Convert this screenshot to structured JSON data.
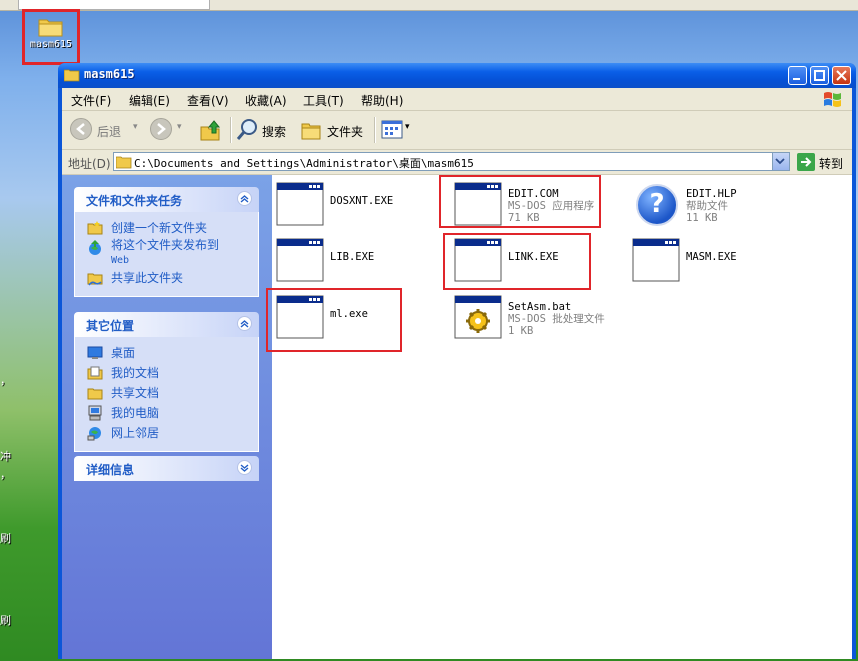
{
  "desktop": {
    "icon_label": "masm615",
    "side_chars": [
      "，",
      "冲",
      "，",
      "刷",
      "刷"
    ]
  },
  "window": {
    "title": "masm615",
    "controls": [
      "minimize",
      "maximize",
      "close"
    ]
  },
  "menu": [
    {
      "label": "文件(F)"
    },
    {
      "label": "编辑(E)"
    },
    {
      "label": "查看(V)"
    },
    {
      "label": "收藏(A)"
    },
    {
      "label": "工具(T)"
    },
    {
      "label": "帮助(H)"
    }
  ],
  "toolbar": {
    "back_label": "后退",
    "search_label": "搜索",
    "folders_label": "文件夹"
  },
  "address": {
    "label": "地址(D)",
    "path": "C:\\Documents and Settings\\Administrator\\桌面\\masm615",
    "go_label": "转到"
  },
  "tasks_panel": {
    "title": "文件和文件夹任务",
    "links": [
      {
        "label": "创建一个新文件夹",
        "icon": "new-folder-icon"
      },
      {
        "label": "将这个文件夹发布到",
        "sub": "Web",
        "icon": "publish-web-icon"
      },
      {
        "label": "共享此文件夹",
        "icon": "share-folder-icon"
      }
    ]
  },
  "other_places": {
    "title": "其它位置",
    "links": [
      {
        "label": "桌面",
        "icon": "desktop-icon"
      },
      {
        "label": "我的文档",
        "icon": "my-documents-icon"
      },
      {
        "label": "共享文档",
        "icon": "shared-documents-icon"
      },
      {
        "label": "我的电脑",
        "icon": "my-computer-icon"
      },
      {
        "label": "网上邻居",
        "icon": "network-icon"
      }
    ]
  },
  "details_panel": {
    "title": "详细信息"
  },
  "files": [
    {
      "name": "DOSXNT.EXE",
      "type": "",
      "size": "",
      "icon": "dos-window-icon",
      "highlighted": false
    },
    {
      "name": "EDIT.COM",
      "type": "MS-DOS 应用程序",
      "size": "71 KB",
      "icon": "dos-window-icon",
      "highlighted": true
    },
    {
      "name": "EDIT.HLP",
      "type": "帮助文件",
      "size": "11 KB",
      "icon": "help-icon",
      "highlighted": false
    },
    {
      "name": "LIB.EXE",
      "type": "",
      "size": "",
      "icon": "dos-window-icon",
      "highlighted": false
    },
    {
      "name": "LINK.EXE",
      "type": "",
      "size": "",
      "icon": "dos-window-icon",
      "highlighted": true
    },
    {
      "name": "MASM.EXE",
      "type": "",
      "size": "",
      "icon": "dos-window-icon",
      "highlighted": false
    },
    {
      "name": "ml.exe",
      "type": "",
      "size": "",
      "icon": "dos-window-icon",
      "highlighted": true
    },
    {
      "name": "SetAsm.bat",
      "type": "MS-DOS 批处理文件",
      "size": "1 KB",
      "icon": "batch-gear-icon",
      "highlighted": false
    }
  ],
  "colors": {
    "highlight": "#e0252a",
    "title_bar": "#0a5fe8",
    "task_link": "#215dc6"
  }
}
